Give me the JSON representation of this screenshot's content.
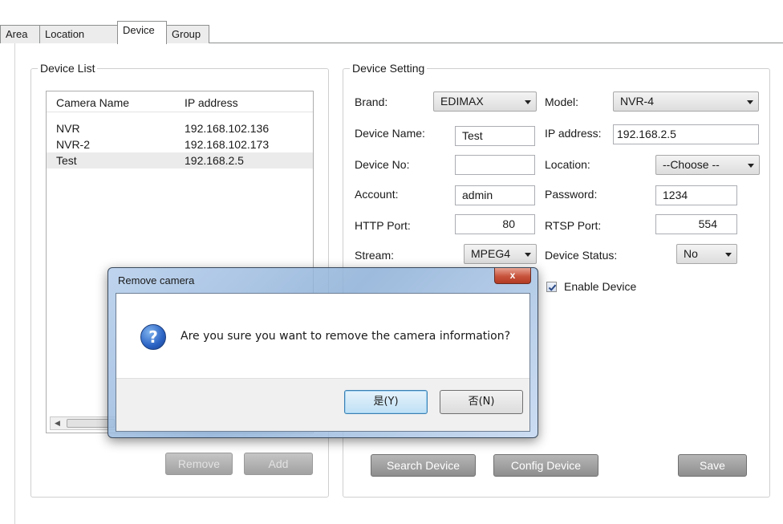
{
  "tabs": [
    "Area",
    "Location",
    "Device",
    "Group"
  ],
  "active_tab": "Device",
  "device_list": {
    "title": "Device List",
    "columns": [
      "Camera Name",
      "IP address"
    ],
    "rows": [
      {
        "name": "NVR",
        "ip": "192.168.102.136"
      },
      {
        "name": "NVR-2",
        "ip": "192.168.102.173"
      },
      {
        "name": "Test",
        "ip": "192.168.2.5"
      }
    ],
    "selected_row": "Test",
    "remove_label": "Remove",
    "add_label": "Add"
  },
  "device_setting": {
    "title": "Device Setting",
    "brand_label": "Brand:",
    "brand_value": "EDIMAX",
    "model_label": "Model:",
    "model_value": "NVR-4",
    "device_name_label": "Device Name:",
    "device_name_value": "Test",
    "ip_label": "IP address:",
    "ip_value": "192.168.2.5",
    "device_no_label": "Device No:",
    "device_no_value": "",
    "location_label": "Location:",
    "location_value": "--Choose --",
    "account_label": "Account:",
    "account_value": "admin",
    "password_label": "Password:",
    "password_value": "1234",
    "http_port_label": "HTTP Port:",
    "http_port_value": "80",
    "rtsp_port_label": "RTSP Port:",
    "rtsp_port_value": "554",
    "stream_label": "Stream:",
    "stream_value": "MPEG4",
    "device_status_label": "Device Status:",
    "device_status_value": "No",
    "enable_device_label": "Enable Device",
    "enable_device_checked": true,
    "search_label": "Search Device",
    "config_label": "Config Device",
    "save_label": "Save"
  },
  "dialog": {
    "title": "Remove camera",
    "close_label": "x",
    "message": "Are you sure you want to remove the camera information?",
    "yes_label": "是(Y)",
    "no_label": "否(N)"
  },
  "icons": {
    "question": "question-icon",
    "check": "check-icon",
    "dropdown": "chevron-down-icon"
  },
  "colors": {
    "button_gray": "#9e9e9e",
    "dialog_glass": "#a9c4e4",
    "close_red": "#c7533c",
    "selected_row": "#ebebeb"
  }
}
